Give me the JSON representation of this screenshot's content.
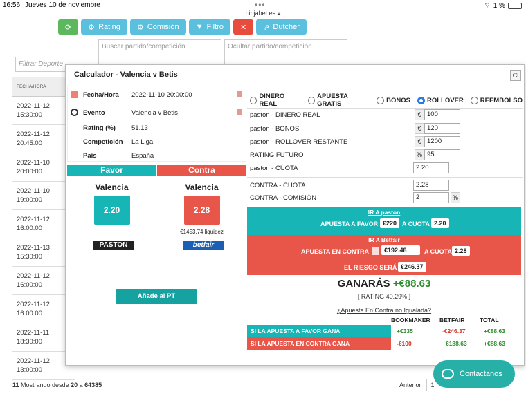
{
  "statusbar": {
    "time": "16:56",
    "date": "Jueves 10 de noviembre",
    "battery": "1 %"
  },
  "browser": {
    "url": "ninjabet.es"
  },
  "toolbar": {
    "rating": "Rating",
    "comision": "Comisión",
    "filtro": "Filtro",
    "dutcher": "Dutcher"
  },
  "filters": {
    "deporte": "Filtrar Deporte",
    "buscar": "Buscar partido/competición",
    "ocultar": "Ocultar partido/competición"
  },
  "table": {
    "header": "FECHA/HORA",
    "rows": [
      {
        "date": "2022-11-12",
        "time": "15:30:00"
      },
      {
        "date": "2022-11-12",
        "time": "20:45:00"
      },
      {
        "date": "2022-11-10",
        "time": "20:00:00"
      },
      {
        "date": "2022-11-10",
        "time": "19:00:00"
      },
      {
        "date": "2022-11-12",
        "time": "16:00:00"
      },
      {
        "date": "2022-11-13",
        "time": "15:30:00"
      },
      {
        "date": "2022-11-12",
        "time": "16:00:00"
      },
      {
        "date": "2022-11-12",
        "time": "16:00:00"
      },
      {
        "date": "2022-11-11",
        "time": "18:30:00"
      },
      {
        "date": "2022-11-12",
        "time": "13:00:00"
      }
    ]
  },
  "footer": {
    "count": "11",
    "text": "Mostrando desde",
    "from": "20",
    "a": "a",
    "total": "64385",
    "prev": "Anterior",
    "page": "1"
  },
  "modal": {
    "title": "Calculador - Valencia v Betis",
    "close": "Cl",
    "info": {
      "fecha_label": "Fecha/Hora",
      "fecha": "2022-11-10 20:00:00",
      "evento_label": "Evento",
      "evento": "Valencia v Betis",
      "rating_label": "Rating (%)",
      "rating": "51.13",
      "competicion_label": "Competición",
      "competicion": "La Liga",
      "pais_label": "País",
      "pais": "España"
    },
    "favor": {
      "header": "Favor",
      "team": "Valencia",
      "odds": "2.20",
      "logo": "PASTON"
    },
    "contra": {
      "header": "Contra",
      "team": "Valencia",
      "odds": "2.28",
      "liquidez": "€1453.74 liquidez",
      "logo": "betfair"
    },
    "add_pt": "Añade al PT",
    "modes": [
      "DINERO REAL",
      "APUESTA GRATIS",
      "BONOS",
      "ROLLOVER",
      "REEMBOLSO"
    ],
    "selected_mode": "ROLLOVER",
    "fields": {
      "dinero_label": "paston - DINERO REAL",
      "dinero": "100",
      "bonos_label": "paston - BONOS",
      "bonos": "120",
      "rollover_label": "paston - ROLLOVER RESTANTE",
      "rollover": "1200",
      "rating_label": "RATING FUTURO",
      "rating": "95",
      "cuota_label": "paston - CUOTA",
      "cuota": "2.20",
      "contra_cuota_label": "CONTRA - CUOTA",
      "contra_cuota": "2.28",
      "comision_label": "CONTRA - COMISIÓN",
      "comision": "2",
      "euro": "€",
      "pct": "%"
    },
    "ir_paston": "IR A paston",
    "apuesta_favor_label": "APUESTA A FAVOR",
    "apuesta_favor": "€220",
    "a_cuota": "A CUOTA",
    "favor_cuota": "2.20",
    "ir_betfair": "IR A Betfair",
    "apuesta_contra_label": "APUESTA EN CONTRA",
    "apuesta_contra": "€192.48",
    "contra_cuota": "2.28",
    "riesgo_label": "EL RIESGO SERÁ",
    "riesgo": "€246.37",
    "ganaras_label": "GANARÁS",
    "ganaras": "+€88.63",
    "rating_line": "[ RATING 40.29% ]",
    "no_igualada": "¿Apuesta En Contra no Igualada?",
    "results": {
      "headers": [
        "BOOKMAKER",
        "BETFAIR",
        "TOTAL"
      ],
      "rows": [
        {
          "label": "SI LA APUESTA A FAVOR GANA",
          "bookmaker": "+€335",
          "betfair": "-€246.37",
          "total": "+€88.63"
        },
        {
          "label": "SI LA APUESTA EN CONTRA GANA",
          "bookmaker": "-€100",
          "betfair": "+€188.63",
          "total": "+€88.63"
        }
      ]
    }
  },
  "contact": "Contactanos",
  "colors": {
    "teal": "#17b5b5",
    "red": "#e8564a",
    "green": "#2e8b2e",
    "accent": "#5bc0de"
  }
}
